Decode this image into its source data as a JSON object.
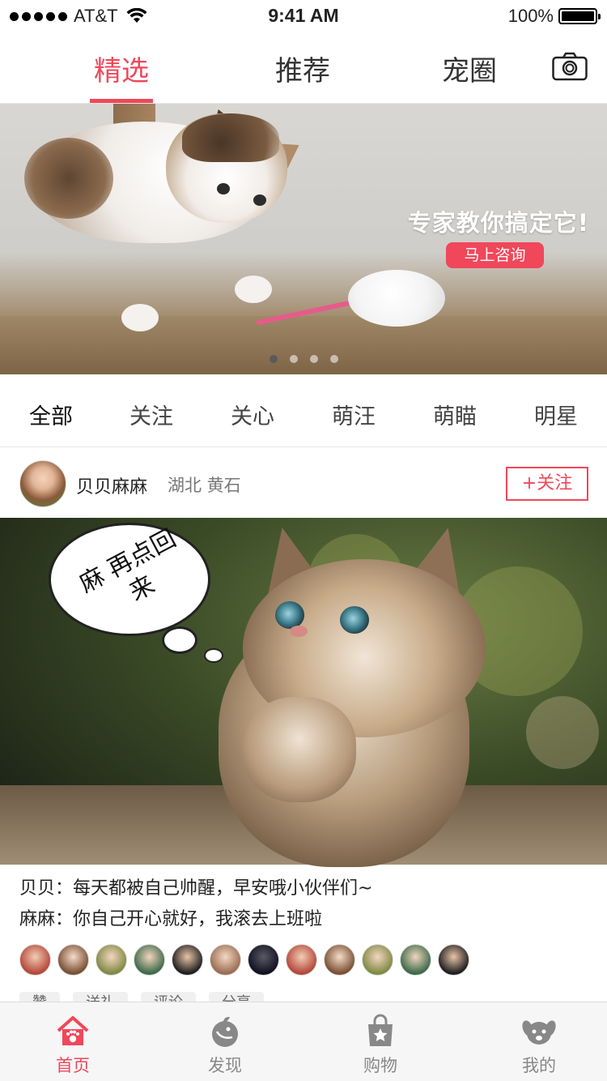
{
  "status_bar": {
    "carrier": "AT&T",
    "time": "9:41 AM",
    "battery": "100%"
  },
  "top_tabs": [
    {
      "label": "精选",
      "active": true
    },
    {
      "label": "推荐",
      "active": false
    },
    {
      "label": "宠圈",
      "active": false
    }
  ],
  "top_icons": {
    "camera": "camera-icon"
  },
  "banner": {
    "headline": "专家教你搞定它!",
    "button": "马上咨询",
    "pages": 4,
    "current_page": 1
  },
  "categories": [
    {
      "label": "全部",
      "active": true
    },
    {
      "label": "关注",
      "active": false
    },
    {
      "label": "关心",
      "active": false
    },
    {
      "label": "萌汪",
      "active": false
    },
    {
      "label": "萌瞄",
      "active": false
    },
    {
      "label": "明星",
      "active": false
    }
  ],
  "post": {
    "user_name": "贝贝麻麻",
    "location": "湖北 黄石",
    "follow_label": "+关注",
    "bubble_text": "麻 再点回来",
    "lines": [
      "贝贝：每天都被自己帅醒，早安哦小伙伴们~",
      "麻麻：你自己开心就好，我滚去上班啦"
    ],
    "liker_count": 12,
    "actions": [
      "赞",
      "送礼",
      "评论",
      "分享"
    ]
  },
  "bottom_nav": [
    {
      "label": "首页",
      "icon": "home-icon",
      "active": true
    },
    {
      "label": "发现",
      "icon": "discover-icon",
      "active": false
    },
    {
      "label": "购物",
      "icon": "shopping-bag-icon",
      "active": false
    },
    {
      "label": "我的",
      "icon": "profile-dog-icon",
      "active": false
    }
  ],
  "colors": {
    "accent": "#f0475a",
    "text": "#222222",
    "muted": "#888888",
    "nav_bg": "#f6f6f6"
  }
}
